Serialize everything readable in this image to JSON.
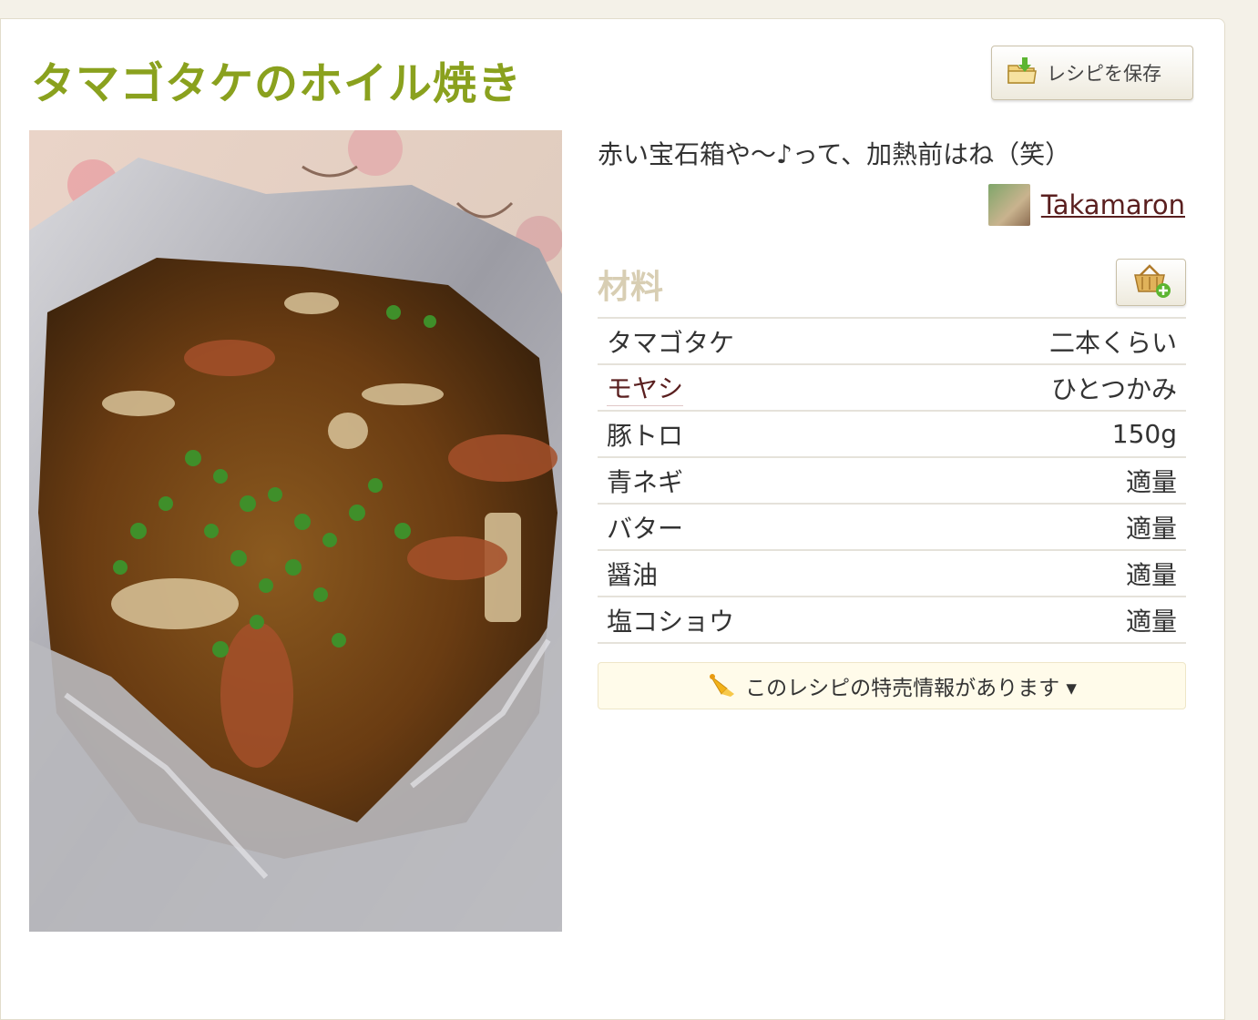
{
  "recipe": {
    "title": "タマゴタケのホイル焼き",
    "save_label": "レシピを保存",
    "description": "赤い宝石箱や〜♪って、加熱前はね（笑）",
    "author": "Takamaron"
  },
  "ingredients": {
    "heading": "材料",
    "items": [
      {
        "name": "タマゴタケ",
        "qty": "二本くらい"
      },
      {
        "name": "モヤシ",
        "qty": "ひとつかみ"
      },
      {
        "name": "豚トロ",
        "qty": "150g"
      },
      {
        "name": "青ネギ",
        "qty": "適量"
      },
      {
        "name": "バター",
        "qty": "適量"
      },
      {
        "name": "醤油",
        "qty": "適量"
      },
      {
        "name": "塩コショウ",
        "qty": "適量"
      }
    ]
  },
  "promo": {
    "label": "このレシピの特売情報があります ▾"
  },
  "icons": {
    "save": "folder-download-icon",
    "basket": "basket-add-icon",
    "megaphone": "megaphone-icon"
  },
  "colors": {
    "title": "#8aa11e",
    "link": "#5a1f1f",
    "heading": "#d8ceb3"
  }
}
